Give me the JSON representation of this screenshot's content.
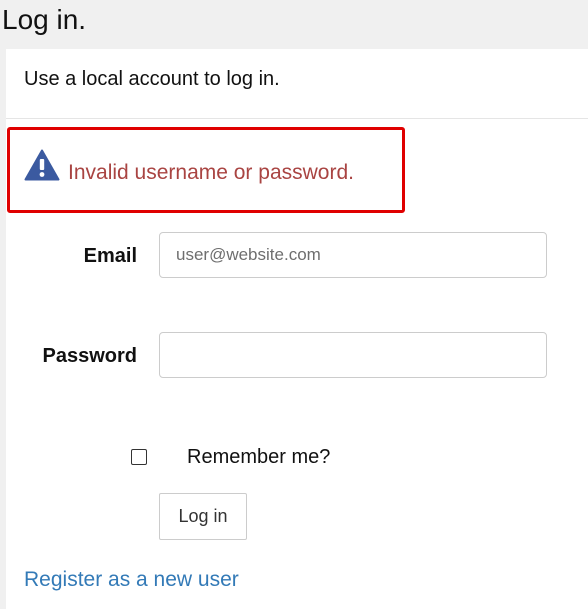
{
  "page": {
    "title": "Log in."
  },
  "form": {
    "subtitle": "Use a local account to log in.",
    "error": {
      "icon": "warning-triangle-icon",
      "message": "Invalid username or password.",
      "color": "#a94442",
      "highlight_border_color": "#e00000"
    },
    "email": {
      "label": "Email",
      "value": "",
      "placeholder": "user@website.com"
    },
    "password": {
      "label": "Password",
      "value": "",
      "placeholder": ""
    },
    "remember": {
      "label": "Remember me?",
      "checked": false
    },
    "submit_label": "Log in",
    "register_link": "Register as a new user",
    "link_color": "#337ab7"
  }
}
